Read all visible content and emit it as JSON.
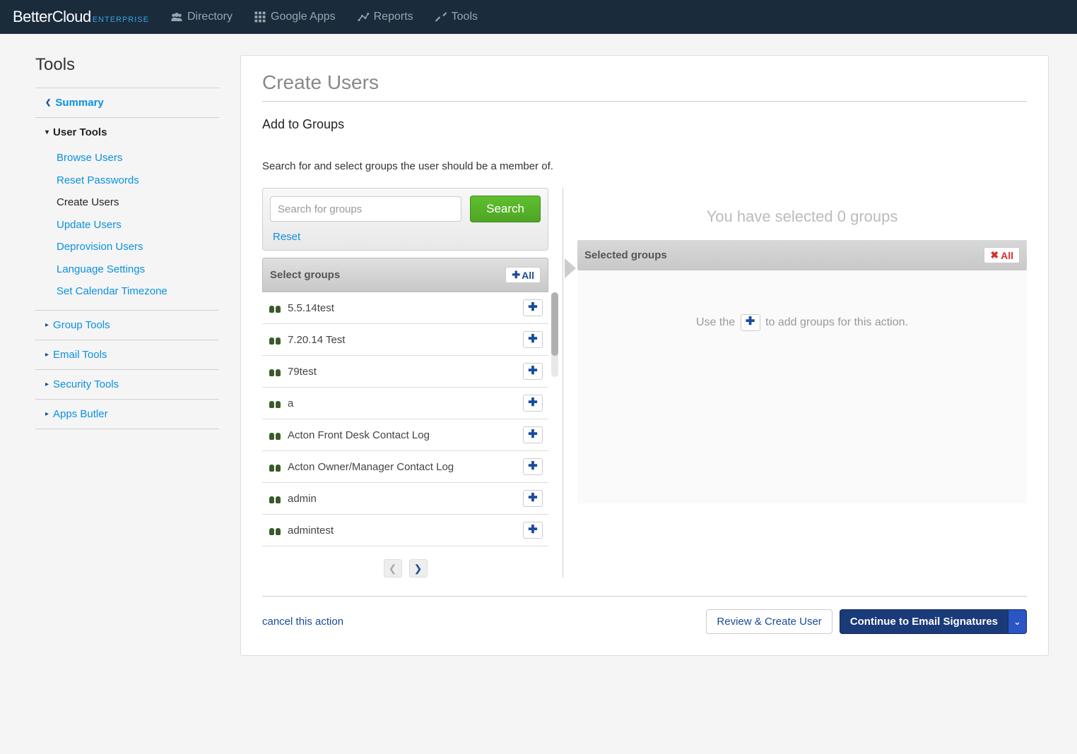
{
  "brand": {
    "name": "BetterCloud",
    "tier": "ENTERPRISE"
  },
  "topnav": [
    {
      "label": "Directory"
    },
    {
      "label": "Google Apps"
    },
    {
      "label": "Reports"
    },
    {
      "label": "Tools"
    }
  ],
  "sidebar": {
    "title": "Tools",
    "summary": "Summary",
    "sections": [
      {
        "label": "User Tools",
        "expanded": true,
        "items": [
          "Browse Users",
          "Reset Passwords",
          "Create Users",
          "Update Users",
          "Deprovision Users",
          "Language Settings",
          "Set Calendar Timezone"
        ],
        "current": "Create Users"
      },
      {
        "label": "Group Tools"
      },
      {
        "label": "Email Tools"
      },
      {
        "label": "Security Tools"
      },
      {
        "label": "Apps Butler"
      }
    ]
  },
  "main": {
    "title": "Create Users",
    "section": "Add to Groups",
    "instruction": "Search for and select groups the user should be a member of.",
    "search": {
      "placeholder": "Search for groups",
      "button": "Search",
      "reset": "Reset"
    },
    "select_header": "Select groups",
    "add_all": "All",
    "groups": [
      "5.5.14test",
      "7.20.14 Test",
      "79test",
      "a",
      "Acton Front Desk Contact Log",
      "Acton Owner/Manager Contact Log",
      "admin",
      "admintest"
    ],
    "selected_count": 0,
    "selected_msg_prefix": "You have selected ",
    "selected_msg_suffix": " groups",
    "selected_header": "Selected groups",
    "remove_all": "All",
    "hint_prefix": "Use the ",
    "hint_suffix": " to add groups for this action.",
    "cancel": "cancel this action",
    "review_btn": "Review & Create User",
    "continue_btn": "Continue to Email Signatures"
  }
}
